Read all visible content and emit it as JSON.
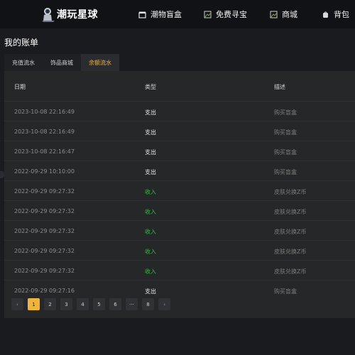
{
  "header": {
    "logo_text": "潮玩星球",
    "nav": [
      {
        "label": "潮物盲盒",
        "icon": "box-icon"
      },
      {
        "label": "免费寻宝",
        "icon": "treasure-icon"
      },
      {
        "label": "商城",
        "icon": "shop-icon"
      },
      {
        "label": "背包",
        "icon": "backpack-icon"
      }
    ]
  },
  "page": {
    "title": "我的账单"
  },
  "tabs": [
    {
      "label": "充值流水",
      "active": false
    },
    {
      "label": "饰品商城",
      "active": false
    },
    {
      "label": "余额流水",
      "active": true
    }
  ],
  "table": {
    "columns": [
      "日期",
      "类型",
      "描述"
    ],
    "rows": [
      {
        "date": "2023-10-08 22:16:49",
        "type": "支出",
        "desc": "购买盲盒",
        "kind": "expense"
      },
      {
        "date": "2023-10-08 22:16:49",
        "type": "支出",
        "desc": "购买盲盒",
        "kind": "expense"
      },
      {
        "date": "2023-10-08 22:16:47",
        "type": "支出",
        "desc": "购买盲盒",
        "kind": "expense"
      },
      {
        "date": "2022-09-29 10:10:00",
        "type": "支出",
        "desc": "购买盲盒",
        "kind": "expense"
      },
      {
        "date": "2022-09-29 09:27:32",
        "type": "收入",
        "desc": "皮肤兑换Z币",
        "kind": "income"
      },
      {
        "date": "2022-09-29 09:27:32",
        "type": "收入",
        "desc": "皮肤兑换Z币",
        "kind": "income"
      },
      {
        "date": "2022-09-29 09:27:32",
        "type": "收入",
        "desc": "皮肤兑换Z币",
        "kind": "income"
      },
      {
        "date": "2022-09-29 09:27:32",
        "type": "收入",
        "desc": "皮肤兑换Z币",
        "kind": "income"
      },
      {
        "date": "2022-09-29 09:27:32",
        "type": "收入",
        "desc": "皮肤兑换Z币",
        "kind": "income"
      },
      {
        "date": "2022-09-29 09:27:16",
        "type": "支出",
        "desc": "购买盲盒",
        "kind": "expense"
      }
    ]
  },
  "pagination": {
    "prev": "‹",
    "next": "›",
    "pages": [
      "1",
      "2",
      "3",
      "4",
      "5",
      "6",
      "···",
      "8"
    ],
    "current": "1"
  },
  "colors": {
    "accent": "#f0b43a",
    "income": "#39b54a"
  }
}
